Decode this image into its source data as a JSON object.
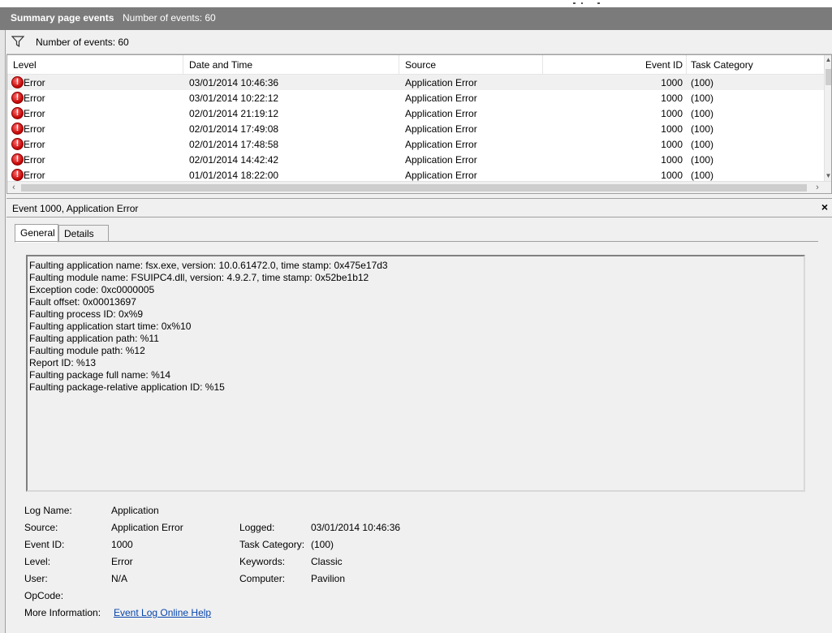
{
  "summary": {
    "title": "Summary page events",
    "count_label": "Number of events: 60"
  },
  "filter": {
    "icon": "filter-icon",
    "text": "Number of events: 60"
  },
  "grid": {
    "columns": [
      "Level",
      "Date and Time",
      "Source",
      "Event ID",
      "Task Category"
    ],
    "rows": [
      {
        "level": "Error",
        "date": "03/01/2014 10:46:36",
        "source": "Application Error",
        "id": "1000",
        "category": "(100)"
      },
      {
        "level": "Error",
        "date": "03/01/2014 10:22:12",
        "source": "Application Error",
        "id": "1000",
        "category": "(100)"
      },
      {
        "level": "Error",
        "date": "02/01/2014 21:19:12",
        "source": "Application Error",
        "id": "1000",
        "category": "(100)"
      },
      {
        "level": "Error",
        "date": "02/01/2014 17:49:08",
        "source": "Application Error",
        "id": "1000",
        "category": "(100)"
      },
      {
        "level": "Error",
        "date": "02/01/2014 17:48:58",
        "source": "Application Error",
        "id": "1000",
        "category": "(100)"
      },
      {
        "level": "Error",
        "date": "02/01/2014 14:42:42",
        "source": "Application Error",
        "id": "1000",
        "category": "(100)"
      },
      {
        "level": "Error",
        "date": "01/01/2014 18:22:00",
        "source": "Application Error",
        "id": "1000",
        "category": "(100)"
      }
    ]
  },
  "detail": {
    "title": "Event 1000, Application Error",
    "close": "×",
    "tabs": [
      "General",
      "Details"
    ],
    "description": [
      "Faulting application name: fsx.exe, version: 10.0.61472.0, time stamp: 0x475e17d3",
      "Faulting module name: FSUIPC4.dll, version: 4.9.2.7, time stamp: 0x52be1b12",
      "Exception code: 0xc0000005",
      "Fault offset: 0x00013697",
      "Faulting process ID: 0x%9",
      "Faulting application start time: 0x%10",
      "Faulting application path: %11",
      "Faulting module path: %12",
      "Report ID: %13",
      "Faulting package full name: %14",
      "Faulting package-relative application ID: %15"
    ],
    "props": {
      "log_name_label": "Log Name:",
      "log_name": "Application",
      "source_label": "Source:",
      "source": "Application Error",
      "logged_label": "Logged:",
      "logged": "03/01/2014 10:46:36",
      "event_id_label": "Event ID:",
      "event_id": "1000",
      "task_category_label": "Task Category:",
      "task_category": "(100)",
      "level_label": "Level:",
      "level": "Error",
      "keywords_label": "Keywords:",
      "keywords": "Classic",
      "user_label": "User:",
      "user": "N/A",
      "computer_label": "Computer:",
      "computer": "Pavilion",
      "opcode_label": "OpCode:",
      "opcode": "",
      "more_info_label": "More Information:",
      "more_info_link": "Event Log Online Help"
    }
  }
}
